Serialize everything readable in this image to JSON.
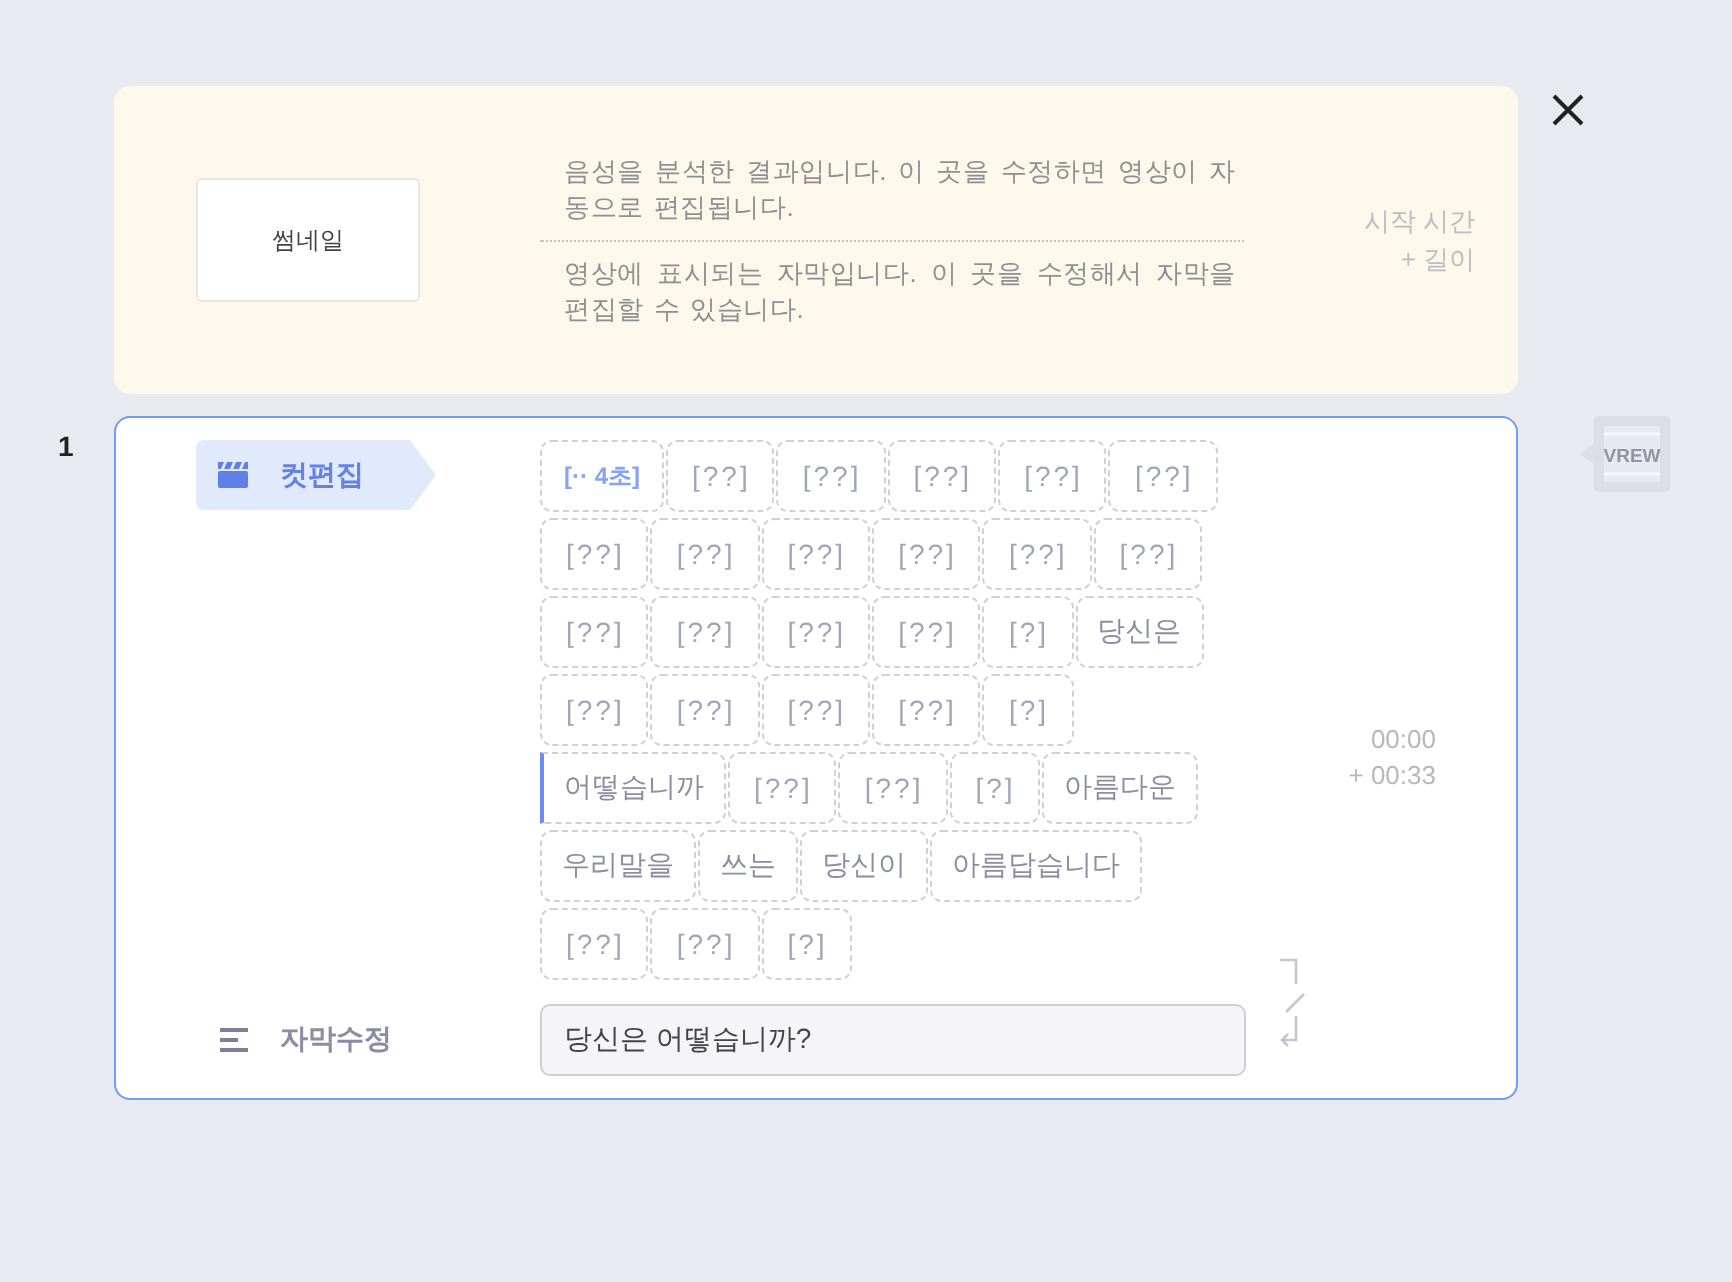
{
  "header": {
    "thumbnail": "썸네일",
    "analysis_note": "음성을 분석한 결과입니다. 이 곳을 수정하면 영상이 자동으로 편집됩니다.",
    "subtitle_note": "영상에 표시되는 자막입니다. 이 곳을 수정해서 자막을 편집할 수 있습니다.",
    "time_label": "시작 시간",
    "length_label": "+ 길이"
  },
  "clip": {
    "number": "1",
    "cut_edit_label": "컷편집",
    "words": [
      {
        "text": "[·· 4초]",
        "kind": "pause",
        "cursor": false
      },
      {
        "text": "[??]",
        "kind": "unknown",
        "cursor": false
      },
      {
        "text": "[??]",
        "kind": "unknown",
        "cursor": false
      },
      {
        "text": "[??]",
        "kind": "unknown",
        "cursor": false
      },
      {
        "text": "[??]",
        "kind": "unknown",
        "cursor": false
      },
      {
        "text": "[??]",
        "kind": "unknown",
        "cursor": false
      },
      {
        "text": "[??]",
        "kind": "unknown",
        "cursor": false
      },
      {
        "text": "[??]",
        "kind": "unknown",
        "cursor": false
      },
      {
        "text": "[??]",
        "kind": "unknown",
        "cursor": false
      },
      {
        "text": "[??]",
        "kind": "unknown",
        "cursor": false
      },
      {
        "text": "[??]",
        "kind": "unknown",
        "cursor": false
      },
      {
        "text": "[??]",
        "kind": "unknown",
        "cursor": false
      },
      {
        "text": "[??]",
        "kind": "unknown",
        "cursor": false
      },
      {
        "text": "[??]",
        "kind": "unknown",
        "cursor": false
      },
      {
        "text": "[??]",
        "kind": "unknown",
        "cursor": false
      },
      {
        "text": "[??]",
        "kind": "unknown",
        "cursor": false
      },
      {
        "text": "[?]",
        "kind": "unknown",
        "cursor": false
      },
      {
        "text": "당신은",
        "kind": "word",
        "cursor": false
      },
      {
        "text": "[??]",
        "kind": "unknown",
        "cursor": false
      },
      {
        "text": "[??]",
        "kind": "unknown",
        "cursor": false
      },
      {
        "text": "[??]",
        "kind": "unknown",
        "cursor": false
      },
      {
        "text": "[??]",
        "kind": "unknown",
        "cursor": false
      },
      {
        "text": "[?]",
        "kind": "unknown",
        "cursor": false
      },
      {
        "text": "어떻습니까",
        "kind": "word",
        "cursor": true
      },
      {
        "text": "[??]",
        "kind": "unknown",
        "cursor": false
      },
      {
        "text": "[??]",
        "kind": "unknown",
        "cursor": false
      },
      {
        "text": "[?]",
        "kind": "unknown",
        "cursor": false
      },
      {
        "text": "아름다운",
        "kind": "word",
        "cursor": false
      },
      {
        "text": "우리말을",
        "kind": "word",
        "cursor": false
      },
      {
        "text": "쓰는",
        "kind": "word",
        "cursor": false
      },
      {
        "text": "당신이",
        "kind": "word",
        "cursor": false
      },
      {
        "text": "아름답습니다",
        "kind": "word",
        "cursor": false
      },
      {
        "text": "[??]",
        "kind": "unknown",
        "cursor": false
      },
      {
        "text": "[??]",
        "kind": "unknown",
        "cursor": false
      },
      {
        "text": "[?]",
        "kind": "unknown",
        "cursor": false
      }
    ],
    "start_time": "00:00",
    "duration": "+ 00:33",
    "subtitle_edit_label": "자막수정",
    "subtitle_value": "당신은 어떻습니까?"
  },
  "logo": {
    "text": "VREW"
  }
}
